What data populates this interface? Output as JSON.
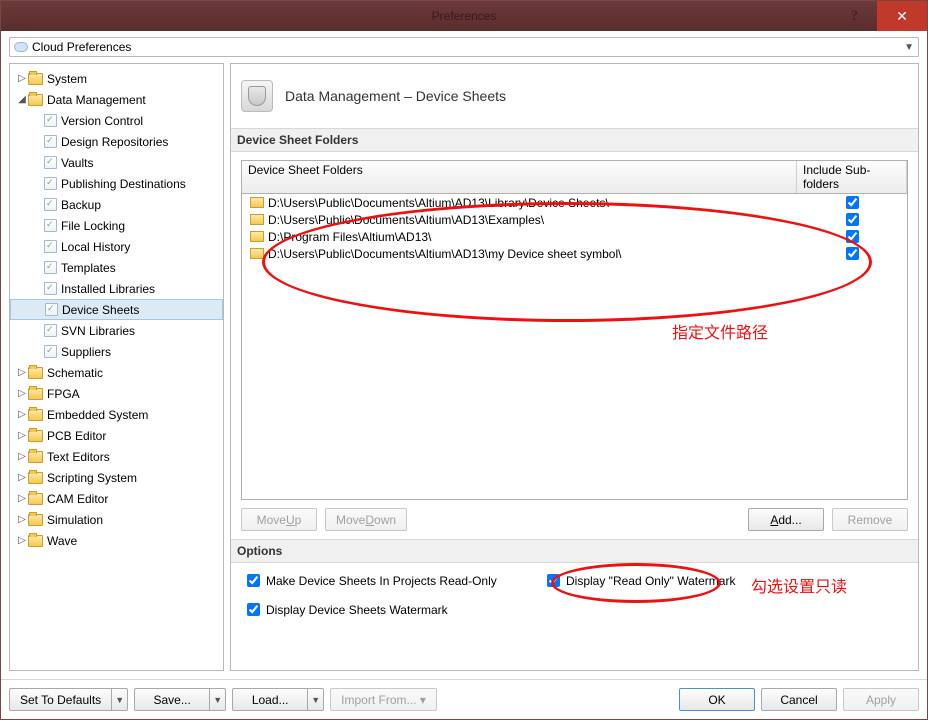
{
  "window": {
    "title": "Preferences"
  },
  "cloud_label": "Cloud Preferences",
  "tree": {
    "system": "System",
    "data_management": "Data Management",
    "dm_children": [
      "Version Control",
      "Design Repositories",
      "Vaults",
      "Publishing Destinations",
      "Backup",
      "File Locking",
      "Local History",
      "Templates",
      "Installed Libraries",
      "Device Sheets",
      "SVN Libraries",
      "Suppliers"
    ],
    "other_roots": [
      "Schematic",
      "FPGA",
      "Embedded System",
      "PCB Editor",
      "Text Editors",
      "Scripting System",
      "CAM Editor",
      "Simulation",
      "Wave"
    ],
    "selected": "Device Sheets"
  },
  "content": {
    "title": "Data Management – Device Sheets",
    "folders_group": "Device Sheet Folders",
    "grid": {
      "col_path": "Device Sheet Folders",
      "col_sub": "Include Sub-folders",
      "rows": [
        {
          "path": "D:\\Users\\Public\\Documents\\Altium\\AD13\\Library\\Device Sheets\\",
          "sub": true
        },
        {
          "path": "D:\\Users\\Public\\Documents\\Altium\\AD13\\Examples\\",
          "sub": true
        },
        {
          "path": "D:\\Program Files\\Altium\\AD13\\",
          "sub": true
        },
        {
          "path": "D:\\Users\\Public\\Documents\\Altium\\AD13\\my Device sheet symbol\\",
          "sub": true
        }
      ]
    },
    "buttons": {
      "move_up": "Move Up",
      "move_down": "Move Down",
      "add": "Add...",
      "remove": "Remove"
    },
    "options_group": "Options",
    "options": {
      "read_only": "Make Device Sheets In Projects Read-Only",
      "watermark": "Display Device Sheets Watermark",
      "ro_watermark": "Display \"Read Only\" Watermark"
    }
  },
  "footer": {
    "set_defaults": "Set To Defaults",
    "save": "Save...",
    "load": "Load...",
    "import": "Import From...",
    "ok": "OK",
    "cancel": "Cancel",
    "apply": "Apply"
  },
  "annotations": {
    "path_label": "指定文件路径",
    "readonly_label": "勾选设置只读"
  }
}
